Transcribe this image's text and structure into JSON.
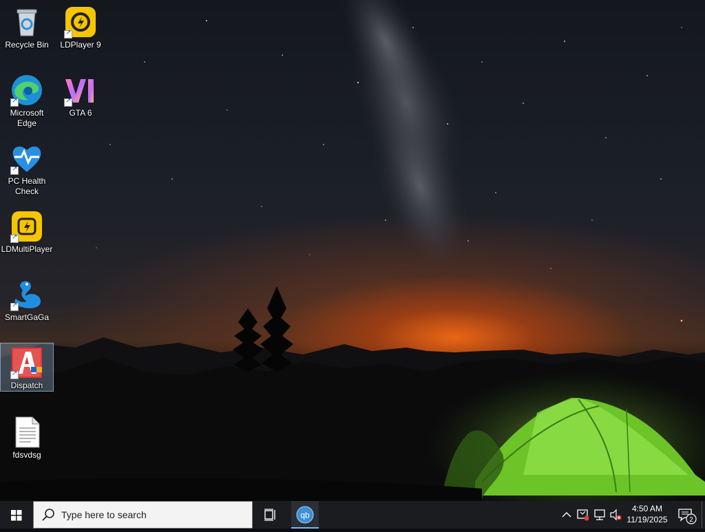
{
  "desktop": {
    "icons": [
      {
        "label": "Recycle Bin",
        "icon": "recycle-bin-icon"
      },
      {
        "label": "LDPlayer 9",
        "icon": "ldplayer-icon"
      },
      {
        "label": "Microsoft Edge",
        "icon": "edge-icon"
      },
      {
        "label": "GTA 6",
        "icon": "gta6-icon"
      },
      {
        "label": "PC Health Check",
        "icon": "pc-health-check-icon"
      },
      {
        "label": "LDMultiPlayer",
        "icon": "ldmultiplayer-icon"
      },
      {
        "label": "SmartGaGa",
        "icon": "smartgaga-icon"
      },
      {
        "label": "Dispatch",
        "icon": "dispatch-icon",
        "selected": true
      },
      {
        "label": "fdsvdsg",
        "icon": "text-file-icon"
      }
    ]
  },
  "taskbar": {
    "search_placeholder": "Type here to search",
    "pinned": [
      {
        "name": "qBittorrent",
        "icon": "qbittorrent-icon",
        "glyph": "qb",
        "active": true
      }
    ],
    "tray": {
      "time": "4:50 AM",
      "date": "11/19/2025",
      "notification_count": "2"
    }
  },
  "colors": {
    "taskbar_bg": "#1a1c20",
    "accent": "#76b9ed",
    "tent_green": "#7fd93a"
  }
}
